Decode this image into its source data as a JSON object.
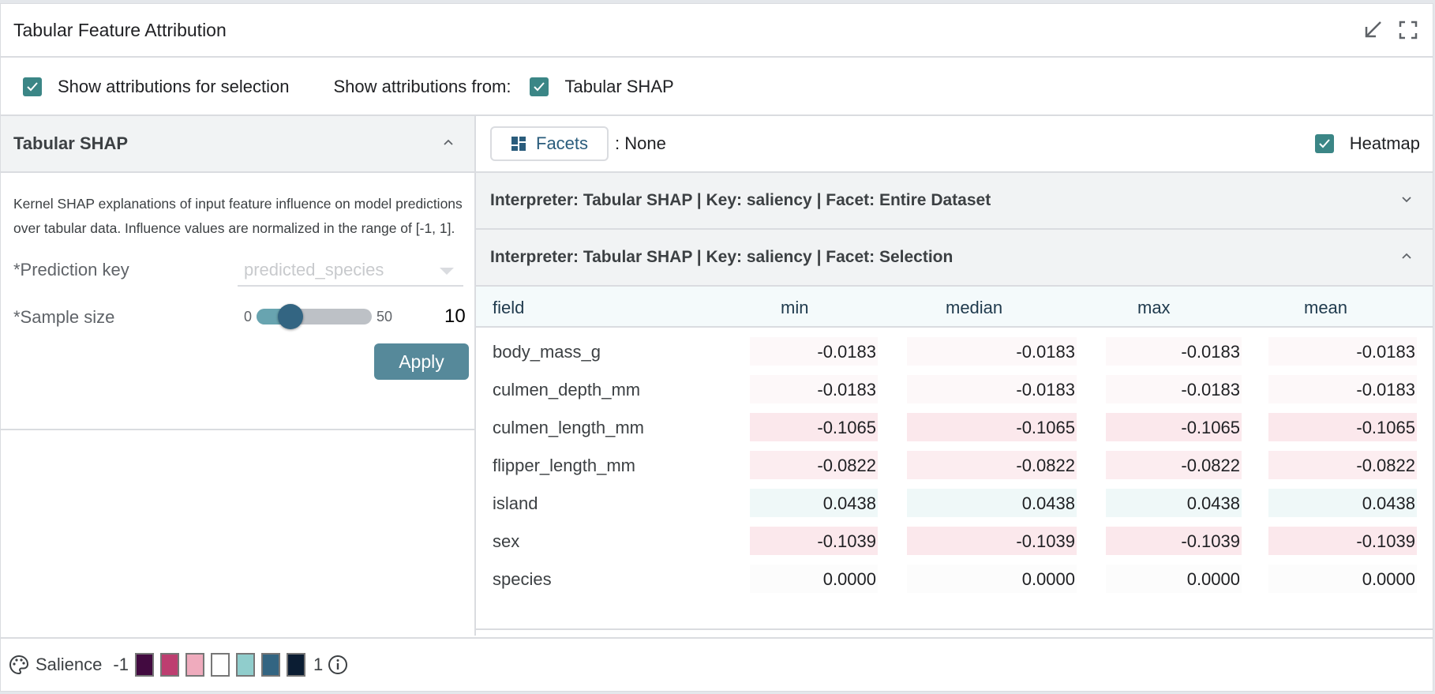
{
  "title": "Tabular Feature Attribution",
  "options": {
    "show_selection": "Show attributions for selection",
    "show_from": "Show attributions from:",
    "method": "Tabular SHAP"
  },
  "left": {
    "title": "Tabular SHAP",
    "description": "Kernel SHAP explanations of input feature influence on model predictions over tabular data. Influence values are normalized in the range of [-1, 1].",
    "pred_key_label": "*Prediction key",
    "pred_key_value": "predicted_species",
    "sample_label": "*Sample size",
    "slider_min": "0",
    "slider_max": "50",
    "sample_value": "10",
    "slider_fraction": 0.2,
    "apply": "Apply"
  },
  "right": {
    "facets": "Facets",
    "facets_value": ": None",
    "heatmap": "Heatmap",
    "group1": "Interpreter: Tabular SHAP | Key: saliency | Facet: Entire Dataset",
    "group2": "Interpreter: Tabular SHAP | Key: saliency | Facet: Selection",
    "columns": [
      "field",
      "min",
      "median",
      "max",
      "mean"
    ],
    "rows": [
      {
        "field": "body_mass_g",
        "v": "-0.0183",
        "bg": "#fdf8f9"
      },
      {
        "field": "culmen_depth_mm",
        "v": "-0.0183",
        "bg": "#fdf8f9"
      },
      {
        "field": "culmen_length_mm",
        "v": "-0.1065",
        "bg": "#fbe8ec"
      },
      {
        "field": "flipper_length_mm",
        "v": "-0.0822",
        "bg": "#fcedf0"
      },
      {
        "field": "island",
        "v": "0.0438",
        "bg": "#eff8f8"
      },
      {
        "field": "sex",
        "v": "-0.1039",
        "bg": "#fbe8ec"
      },
      {
        "field": "species",
        "v": "0.0000",
        "bg": "#fcfcfc"
      }
    ]
  },
  "footer": {
    "label": "Salience",
    "min": "-1",
    "max": "1",
    "colors": [
      "#420a40",
      "#bd3e70",
      "#efabbd",
      "#ffffff",
      "#90cdcc",
      "#336582",
      "#0b1d33"
    ]
  }
}
